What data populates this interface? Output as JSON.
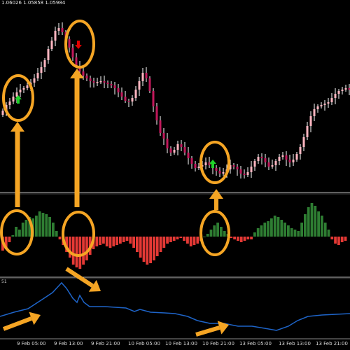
{
  "header": {
    "ohlc_text": "1.06026 1.05858 1.05984"
  },
  "subwindow": {
    "label": "51"
  },
  "time_axis": [
    "9 Feb 05:00",
    "9 Feb 13:00",
    "9 Feb 21:00",
    "10 Feb 05:00",
    "10 Feb 13:00",
    "10 Feb 21:00",
    "13 Feb 05:00",
    "13 Feb 13:00",
    "13 Feb 21:00"
  ],
  "colors": {
    "background": "#000000",
    "bull": "#ffb6c1",
    "bear": "#c2185b",
    "wick": "#ffffff",
    "hist_pos": "#2e7d32",
    "hist_neg": "#e53935",
    "line": "#1e64c8",
    "annotation": "#f5a524",
    "separator": "#bfbfbf",
    "arrow_up": "#1fd12a",
    "arrow_down": "#e10000"
  },
  "icons": {
    "buy": "green-up-arrow",
    "sell": "red-down-arrow"
  }
}
